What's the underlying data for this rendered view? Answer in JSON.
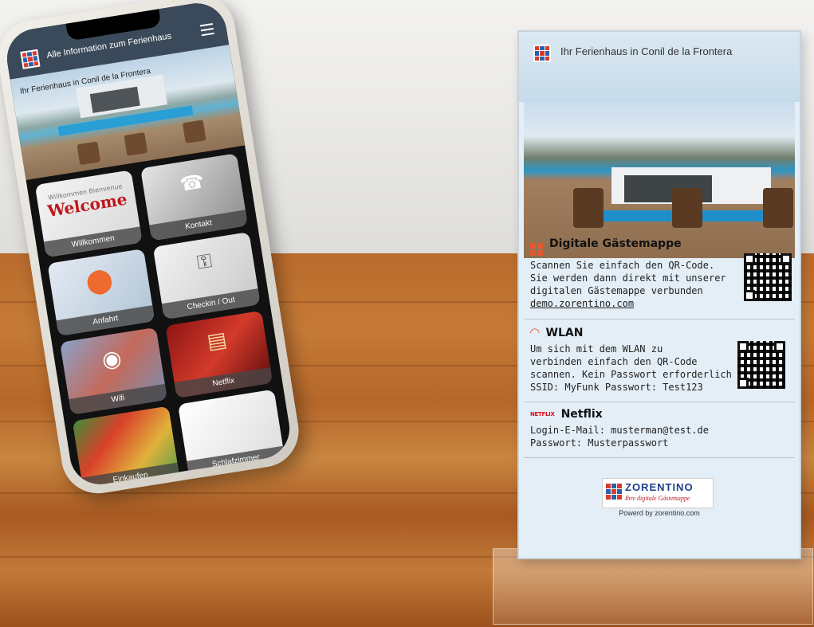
{
  "phone": {
    "header_title": "Alle Information zum Ferienhaus",
    "hero_caption": "Ihr Ferienhaus in Conil de la Frontera",
    "tiles": [
      {
        "label": "Willkommen"
      },
      {
        "label": "Kontakt"
      },
      {
        "label": "Anfahrt"
      },
      {
        "label": "Checkin / Out"
      },
      {
        "label": "Wifi"
      },
      {
        "label": "Netflix"
      },
      {
        "label": "Einkaufen"
      },
      {
        "label": "Schlafzimmer"
      }
    ],
    "welcome_big": "Welcome",
    "welcome_small": "Willkommen Bienvenue"
  },
  "stand": {
    "title": "Ihr Ferienhaus in Conil de la Frontera",
    "sections": {
      "guestbook": {
        "title": "Digitale Gästemappe",
        "lines": [
          "Scannen Sie einfach den QR-Code.",
          "Sie werden dann direkt mit unserer",
          "digitalen Gästemappe verbunden"
        ],
        "link": "demo.zorentino.com"
      },
      "wlan": {
        "title": "WLAN",
        "lines": [
          "Um sich mit dem WLAN zu",
          "verbinden einfach den QR-Code",
          "scannen. Kein Passwort erforderlich",
          "SSID: MyFunk Passwort: Test123"
        ]
      },
      "netflix": {
        "icon_text": "NETFLIX",
        "title": "Netflix",
        "lines": [
          "Login-E-Mail: musterman@test.de",
          "Passwort: Musterpasswort"
        ]
      }
    },
    "brand_name": "ZORENTINO",
    "brand_tagline": "Ihre digitale Gästemappe",
    "powered_by": "Powerd by zorentino.com"
  },
  "colors": {
    "accent": "#e4572e",
    "header": "#3b4a5a",
    "netflix_red": "#e50914"
  }
}
